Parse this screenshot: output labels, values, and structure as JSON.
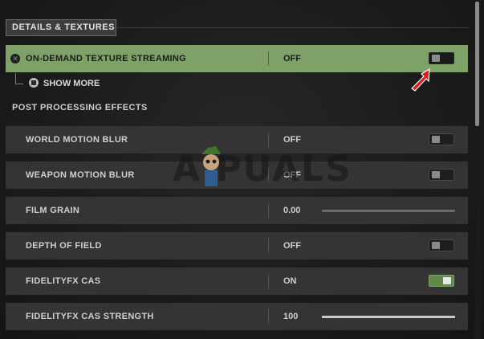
{
  "section_title": "DETAILS & TEXTURES",
  "rows": [
    {
      "label": "ON-DEMAND TEXTURE STREAMING",
      "value": "OFF",
      "control": "toggle",
      "state": "off",
      "highlighted": true
    },
    {
      "label": "WORLD MOTION BLUR",
      "value": "OFF",
      "control": "toggle",
      "state": "off"
    },
    {
      "label": "WEAPON MOTION BLUR",
      "value": "OFF",
      "control": "toggle",
      "state": "off"
    },
    {
      "label": "FILM GRAIN",
      "value": "0.00",
      "control": "slider",
      "level": 0
    },
    {
      "label": "DEPTH OF FIELD",
      "value": "OFF",
      "control": "toggle",
      "state": "off"
    },
    {
      "label": "FIDELITYFX CAS",
      "value": "ON",
      "control": "toggle",
      "state": "on"
    },
    {
      "label": "FIDELITYFX CAS STRENGTH",
      "value": "100",
      "control": "slider",
      "level": 1
    }
  ],
  "show_more": "SHOW MORE",
  "subsection_title": "POST PROCESSING EFFECTS",
  "watermark": "A  PUALS",
  "colors": {
    "highlight": "#7ea167",
    "row_bg": "#343434",
    "toggle_on": "#5f8a4c",
    "cursor": "#e01b1b"
  },
  "icons": {
    "close": "x-circle-icon",
    "show_more": "square-button-icon",
    "cursor": "arrow-cursor-icon"
  }
}
